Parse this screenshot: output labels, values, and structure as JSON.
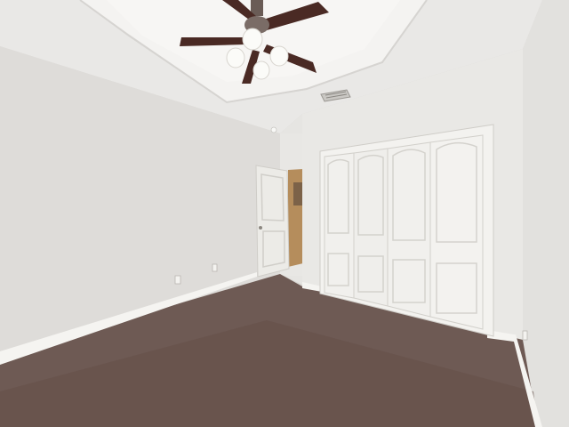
{
  "scene": {
    "kind": "photo",
    "subject": "empty bedroom",
    "colors": {
      "wall_left": "#dedcd9",
      "wall_back": "#e9e8e5",
      "wall_right": "#e4e3e0",
      "ceiling": "#eeedeb",
      "tray_ceiling": "#f4f3f1",
      "carpet": "#6e5a54",
      "trim": "#f5f4f1",
      "door": "#ecebe7",
      "fan_blade": "#4a2a24",
      "hallway": "#b58d5c"
    },
    "objects": [
      {
        "name": "ceiling-fan",
        "count": 1,
        "blades": 5,
        "lights": 4
      },
      {
        "name": "closet-bifold-doors",
        "count": 2,
        "panels": 4
      },
      {
        "name": "open-door",
        "count": 1
      },
      {
        "name": "air-vent",
        "count": 1
      },
      {
        "name": "electrical-outlet",
        "count": 3
      }
    ]
  }
}
